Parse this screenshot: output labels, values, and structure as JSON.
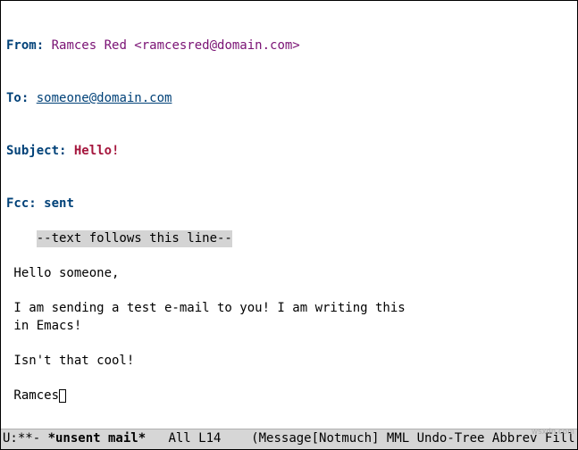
{
  "headers": {
    "from_key": "From:",
    "from_value": " Ramces Red <ramcesred@domain.com>",
    "to_key": "To:",
    "to_value": "someone@domain.com",
    "subject_key": "Subject:",
    "subject_value": "Hello!",
    "fcc_key": "Fcc:",
    "fcc_value": "sent"
  },
  "separator": "--text follows this line--",
  "body": {
    "l0": "",
    "l1": " Hello someone,",
    "l2": "",
    "l3": " I am sending a test e-mail to you! I am writing this",
    "l4": " in Emacs!",
    "l5": "",
    "l6": " Isn't that cool!",
    "l7": "",
    "l8_pre": " Ramces",
    "l9": "",
    "l10": "--"
  },
  "modeline": {
    "left": "U:**- ",
    "buffer_name": "*unsent mail*",
    "position": "   All L14    ",
    "modes": "(Message[Notmuch] MML Undo-Tree Abbrev Fill)"
  },
  "watermark": "wsxdn.com"
}
